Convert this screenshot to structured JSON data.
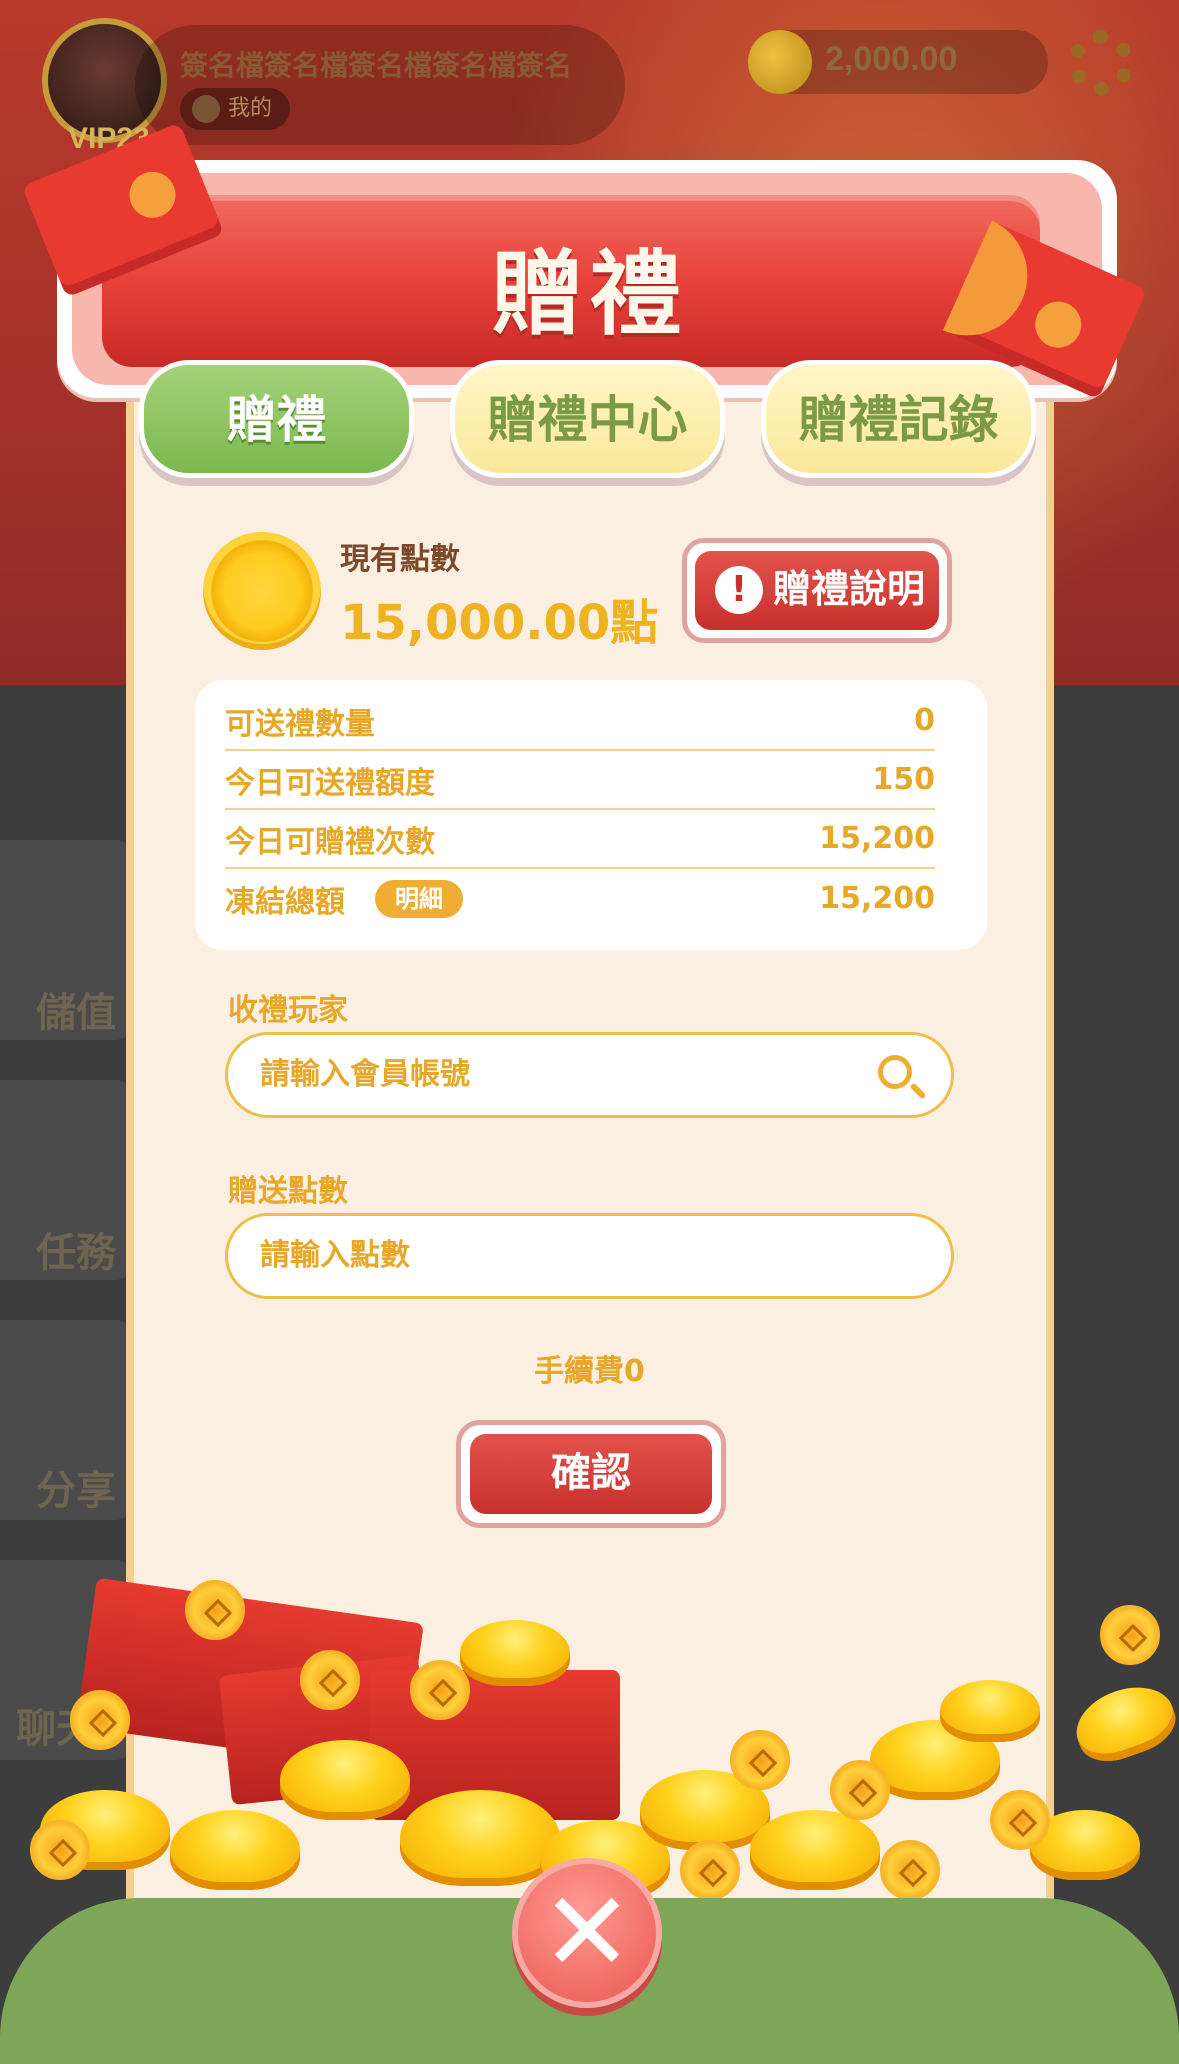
{
  "background": {
    "player_name": "簽名檔簽名檔簽名檔簽名檔簽名",
    "my_label": "我的",
    "vip_label": "VIP23",
    "balance": "2,000.00",
    "side_menu": [
      "儲值",
      "任務",
      "分享",
      "聊天"
    ]
  },
  "modal": {
    "title": "贈禮",
    "tabs": [
      "贈禮",
      "贈禮中心",
      "贈禮記錄"
    ],
    "active_tab": "贈禮",
    "points_label": "現有點數",
    "points_value": "15,000.00點",
    "info_button": "贈禮說明",
    "stats": [
      {
        "label": "可送禮數量",
        "value": "0"
      },
      {
        "label": "今日可送禮額度",
        "value": "150"
      },
      {
        "label": "今日可贈禮次數",
        "value": "15,200"
      },
      {
        "label": "凍結總額",
        "value": "15,200",
        "badge": "明細"
      }
    ],
    "recipient_label": "收禮玩家",
    "recipient_placeholder": "請輸入會員帳號",
    "amount_label": "贈送點數",
    "amount_placeholder": "請輸入點數",
    "fee_text": "手續費0",
    "confirm_label": "確認"
  },
  "colors": {
    "accent_red": "#e8413a",
    "tab_active_green": "#7bb84e",
    "tab_inactive_yellow": "#fbe89a",
    "gold_text": "#e7a82a",
    "bottom_bar_green": "#7ea659"
  },
  "icons": {
    "info": "exclamation-icon",
    "search": "search-icon",
    "close": "close-icon",
    "coin": "coin-icon"
  }
}
